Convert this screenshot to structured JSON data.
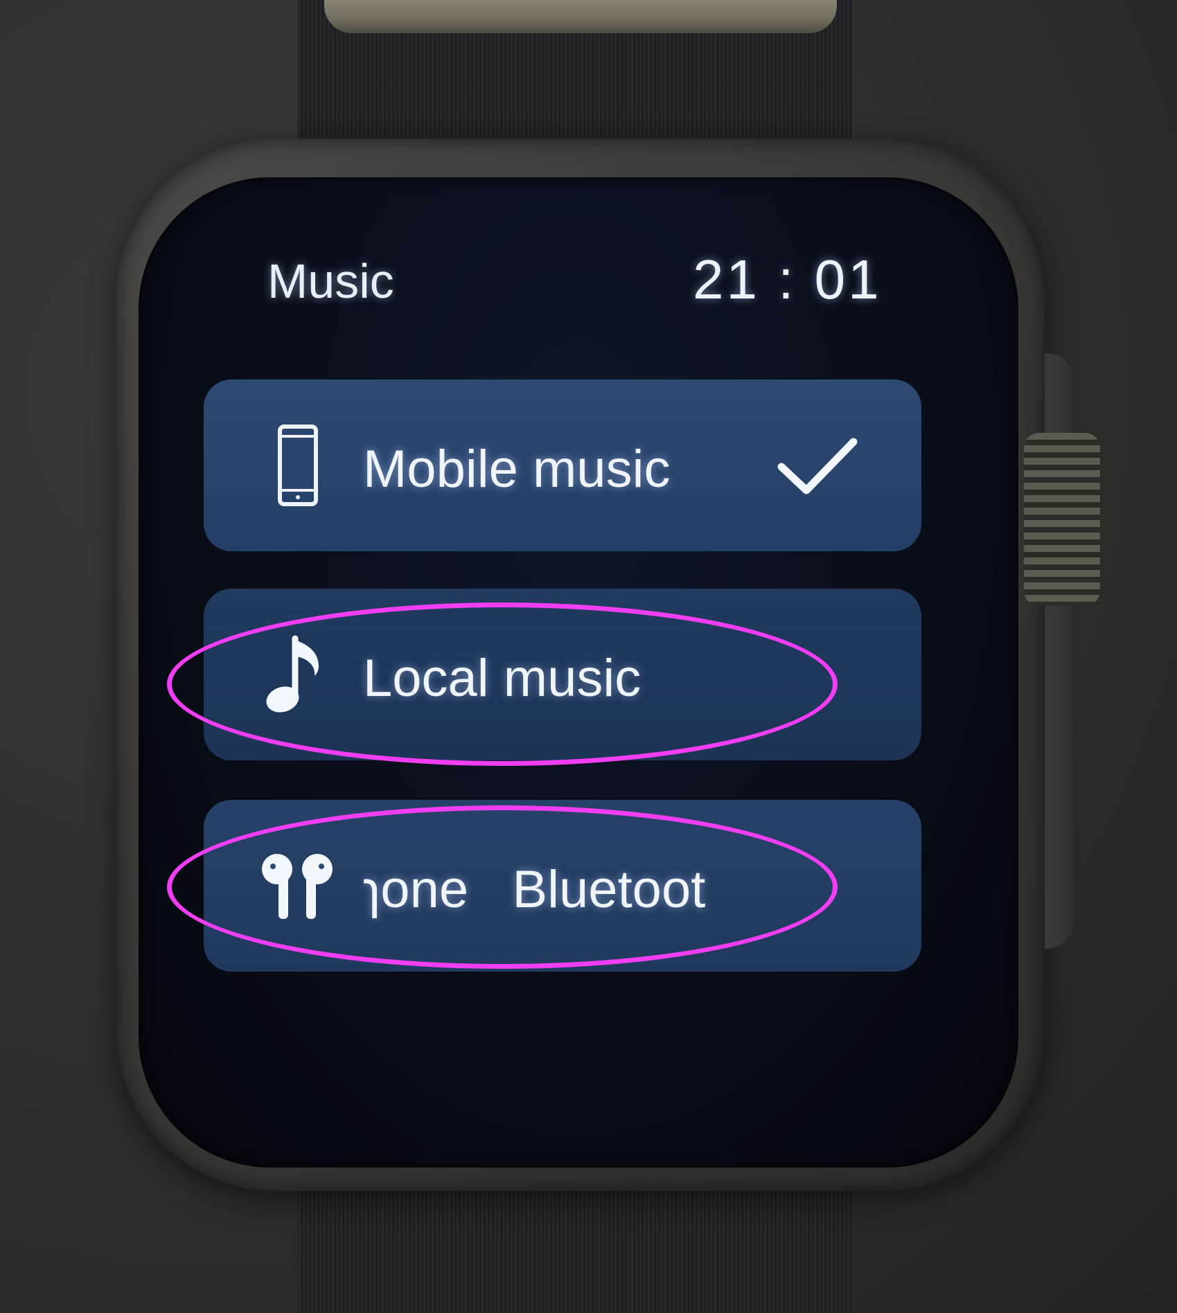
{
  "watch": {
    "status_title": "Music",
    "time": "21 : 01"
  },
  "menu": {
    "items": [
      {
        "icon": "phone-icon",
        "label": "Mobile music",
        "selected": true
      },
      {
        "icon": "music-note-icon",
        "label": "Local music",
        "selected": false
      },
      {
        "icon": "earbuds-icon",
        "label": "ɿone   Bluetoot",
        "selected": false
      }
    ]
  },
  "annotations": {
    "highlight_color": "#f23ef2"
  },
  "colors": {
    "item_background": "#2d4a73",
    "screen_background": "#070b14",
    "text": "#f0f4fb"
  }
}
